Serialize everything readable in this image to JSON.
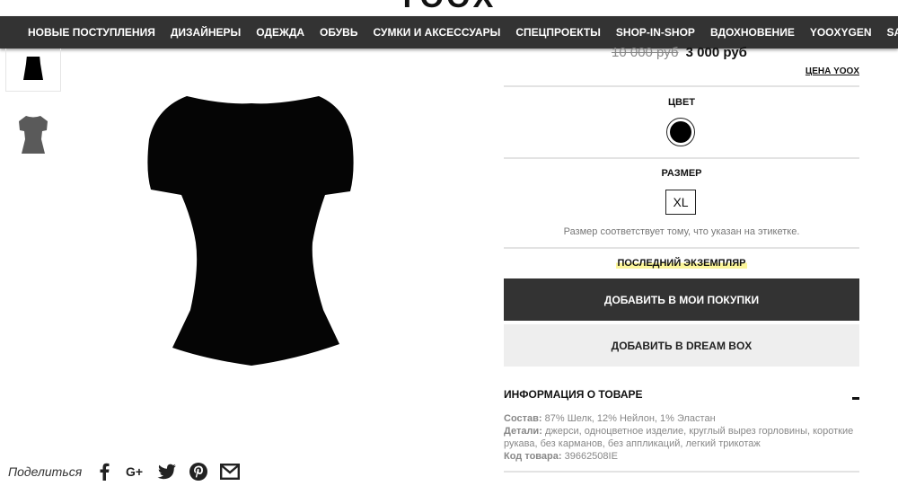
{
  "brand": {
    "logo_text": "YOOX"
  },
  "nav": {
    "items": [
      {
        "label": "НОВЫЕ ПОСТУПЛЕНИЯ"
      },
      {
        "label": "ДИЗАЙНЕРЫ"
      },
      {
        "label": "ОДЕЖДА"
      },
      {
        "label": "ОБУВЬ"
      },
      {
        "label": "СУМКИ И АКСЕССУАРЫ"
      },
      {
        "label": "СПЕЦПРОЕКТЫ"
      },
      {
        "label": "SHOP-IN-SHOP"
      },
      {
        "label": "ВДОХНОВЕНИЕ"
      },
      {
        "label": "YOOXYGEN"
      },
      {
        "label": "SALE"
      }
    ],
    "bg_color": "#333333"
  },
  "gallery": {
    "thumbnails": [
      {
        "name": "thumb-front",
        "color": "#000000"
      },
      {
        "name": "thumb-back",
        "color": "#5a5a5a"
      }
    ],
    "main_image_color": "#000000"
  },
  "price": {
    "old": "10 000 руб",
    "new": "3 000 руб",
    "label": "ЦЕНА YOOX"
  },
  "color_section": {
    "title": "ЦВЕТ",
    "selected_color": "#000000"
  },
  "size_section": {
    "title": "РАЗМЕР",
    "selected": "XL",
    "note": "Размер соответствует тому, что указан на этикетке."
  },
  "stock_notice": "ПОСЛЕДНИЙ ЭКЗЕМПЛЯР",
  "buttons": {
    "add_to_cart": "ДОБАВИТЬ В МОИ ПОКУПКИ",
    "add_to_dreambox": "ДОБАВИТЬ В DREAM BOX"
  },
  "product_info": {
    "title": "ИНФОРМАЦИЯ О ТОВАРЕ",
    "composition_label": "Состав:",
    "composition_value": "87% Шелк, 12% Нейлон, 1% Эластан",
    "details_label": "Детали:",
    "details_value": "джерси, одноцветное изделие, круглый вырез горловины, короткие рукава, без карманов, без аппликаций, легкий трикотаж",
    "code_label": "Код товара:",
    "code_value": "39662508IE"
  },
  "share": {
    "label": "Поделиться",
    "icons": [
      "facebook-icon",
      "google-plus-icon",
      "twitter-icon",
      "pinterest-icon",
      "email-icon"
    ]
  }
}
